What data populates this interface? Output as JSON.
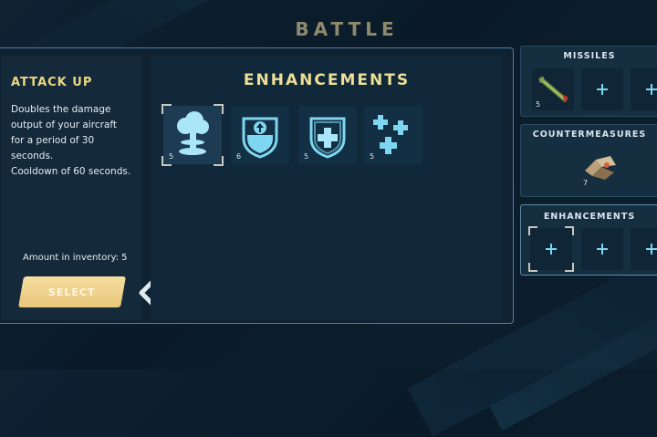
{
  "screen": {
    "title": "BATTLE"
  },
  "info": {
    "title": "ATTACK UP",
    "description_lines": [
      "Doubles the damage",
      "output of your aircraft",
      "for a period of 30",
      "seconds.",
      "Cooldown of 60 seconds."
    ],
    "inventory_text": "Amount in inventory: 5",
    "select_label": "SELECT"
  },
  "enhancements_panel": {
    "title": "ENHANCEMENTS",
    "items": [
      {
        "icon": "mushroom-cloud-icon",
        "count": "5",
        "selected": true
      },
      {
        "icon": "shield-arrow-up-icon",
        "count": "6"
      },
      {
        "icon": "shield-plus-icon",
        "count": "5"
      },
      {
        "icon": "triple-plus-icon",
        "count": "5"
      }
    ]
  },
  "loadout": {
    "missiles": {
      "title": "MISSILES",
      "slots": [
        {
          "icon": "missile-icon",
          "count": "5"
        },
        {
          "icon": "plus-icon"
        },
        {
          "icon": "plus-icon"
        }
      ]
    },
    "countermeasures": {
      "title": "COUNTERMEASURES",
      "slots": [
        {
          "icon": "flare-icon",
          "count": "7"
        }
      ]
    },
    "enhancements": {
      "title": "ENHANCEMENTS",
      "slots": [
        {
          "icon": "plus-icon",
          "selected": true
        },
        {
          "icon": "plus-icon"
        },
        {
          "icon": "plus-icon"
        }
      ]
    }
  },
  "colors": {
    "accent_gold": "#ecd882",
    "icon_cyan": "#7fd6f0",
    "panel_border": "#4e7f9a"
  }
}
